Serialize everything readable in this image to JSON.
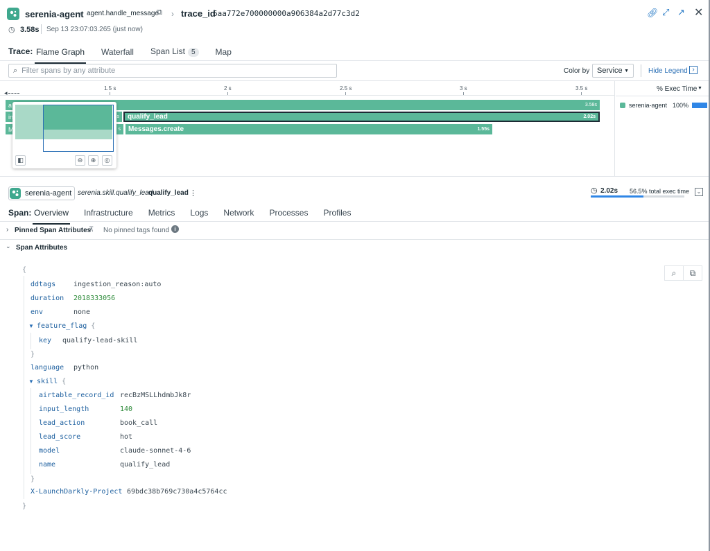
{
  "header": {
    "service": "serenia-agent",
    "operation": "agent.handle_message",
    "trace_label": "trace_id",
    "trace_id": "6aa772e700000000a906384a2d77c3d2",
    "duration": "3.58s",
    "timestamp": "Sep 13 23:07:03.265 (just now)"
  },
  "trace_tabs": {
    "label": "Trace:",
    "items": [
      {
        "label": "Flame Graph",
        "active": true
      },
      {
        "label": "Waterfall"
      },
      {
        "label": "Span List",
        "count": "5"
      },
      {
        "label": "Map"
      }
    ]
  },
  "toolbar": {
    "search_placeholder": "Filter spans by any attribute",
    "color_by_label": "Color by",
    "color_by_value": "Service",
    "hide_legend": "Hide Legend"
  },
  "flame": {
    "ticks": [
      "1.5 s",
      "2 s",
      "2.5 s",
      "3 s",
      "3.5 s"
    ],
    "bars": [
      {
        "label": "a",
        "duration": "3.58s"
      },
      {
        "label": "in",
        "duration": "s"
      },
      {
        "label": "qualify_lead",
        "duration": "2.02s"
      },
      {
        "label": "M",
        "duration": "s"
      },
      {
        "label": "Messages.create",
        "duration": "1.55s"
      }
    ]
  },
  "legend": {
    "header": "% Exec Time",
    "items": [
      {
        "name": "serenia-agent",
        "pct": "100%",
        "color": "#5bb899"
      }
    ]
  },
  "span": {
    "service": "serenia-agent",
    "resource": "serenia.skill.qualify_lead",
    "name": "qualify_lead",
    "exec_duration": "2.02s",
    "exec_pct_label": "56.5% total exec time",
    "exec_pct_value": 56.5
  },
  "span_tabs": {
    "label": "Span:",
    "items": [
      {
        "label": "Overview",
        "active": true
      },
      {
        "label": "Infrastructure"
      },
      {
        "label": "Metrics"
      },
      {
        "label": "Logs"
      },
      {
        "label": "Network"
      },
      {
        "label": "Processes"
      },
      {
        "label": "Profiles"
      }
    ]
  },
  "pinned": {
    "title": "Pinned Span Attributes",
    "empty": "No pinned tags found"
  },
  "attributes": {
    "title": "Span Attributes",
    "rows": {
      "ddtags": {
        "key": "ddtags",
        "value": "ingestion_reason:auto"
      },
      "duration": {
        "key": "duration",
        "value": "2018333056"
      },
      "env": {
        "key": "env",
        "value": "none"
      },
      "feature_flag": {
        "key": "feature_flag"
      },
      "ff_key": {
        "key": "key",
        "value": "qualify-lead-skill"
      },
      "language": {
        "key": "language",
        "value": "python"
      },
      "skill": {
        "key": "skill"
      },
      "airtable": {
        "key": "airtable_record_id",
        "value": "recBzMSLLhdmbJk8r"
      },
      "input_length": {
        "key": "input_length",
        "value": "140"
      },
      "lead_action": {
        "key": "lead_action",
        "value": "book_call"
      },
      "lead_score": {
        "key": "lead_score",
        "value": "hot"
      },
      "model": {
        "key": "model",
        "value": "claude-sonnet-4-6"
      },
      "name": {
        "key": "name",
        "value": "qualify_lead"
      },
      "ld_project": {
        "key": "X-LaunchDarkly-Project",
        "value": "69bdc38b769c730a4c5764cc"
      }
    }
  }
}
